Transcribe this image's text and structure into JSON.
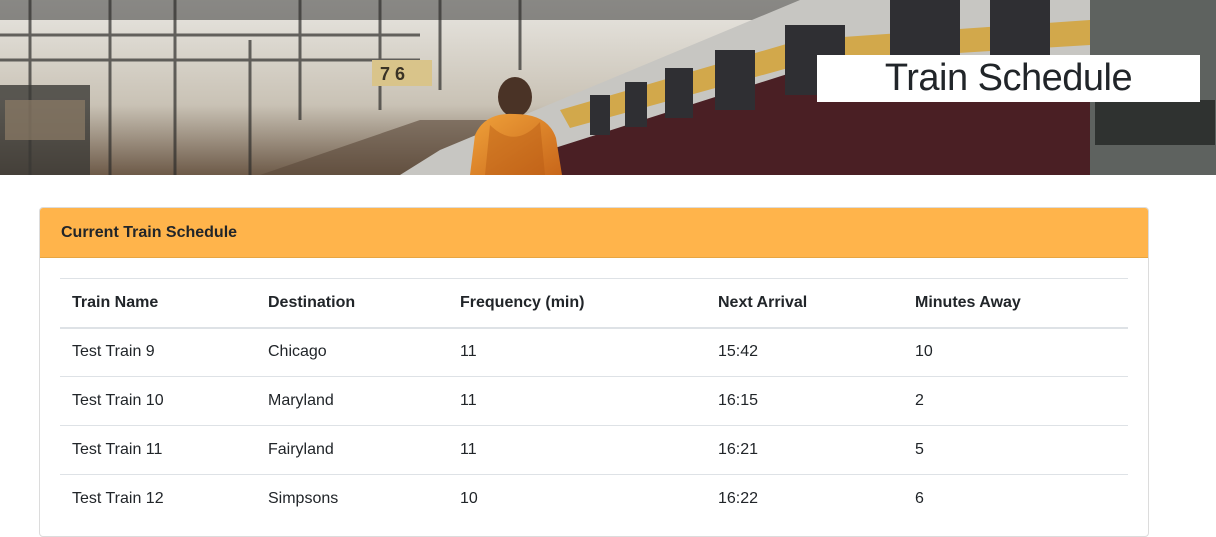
{
  "hero": {
    "title": "Train Schedule"
  },
  "schedule": {
    "title": "Current Train Schedule",
    "accent_color": "#ffb44b",
    "columns": [
      "Train Name",
      "Destination",
      "Frequency (min)",
      "Next Arrival",
      "Minutes Away"
    ],
    "rows": [
      [
        "Test Train 9",
        "Chicago",
        "11",
        "15:42",
        "10"
      ],
      [
        "Test Train 10",
        "Maryland",
        "11",
        "16:15",
        "2"
      ],
      [
        "Test Train 11",
        "Fairyland",
        "11",
        "16:21",
        "5"
      ],
      [
        "Test Train 12",
        "Simpsons",
        "10",
        "16:22",
        "6"
      ]
    ]
  }
}
